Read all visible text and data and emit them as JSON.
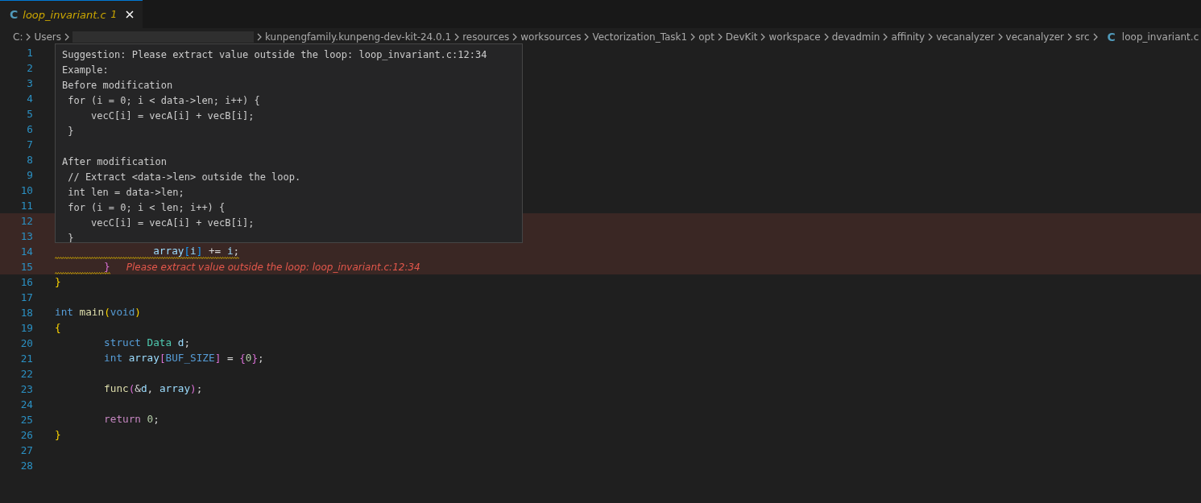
{
  "tabs": [
    {
      "icon": "C",
      "label": "loop_invariant.c",
      "problems": "1",
      "selected": true
    }
  ],
  "breadcrumb": [
    {
      "kind": "folder",
      "label": "C:"
    },
    {
      "kind": "folder",
      "label": "Users"
    },
    {
      "kind": "redacted"
    },
    {
      "kind": "folder",
      "label": "kunpengfamily.kunpeng-dev-kit-24.0.1"
    },
    {
      "kind": "folder",
      "label": "resources"
    },
    {
      "kind": "folder",
      "label": "worksources"
    },
    {
      "kind": "folder",
      "label": "Vectorization_Task1"
    },
    {
      "kind": "folder",
      "label": "opt"
    },
    {
      "kind": "folder",
      "label": "DevKit"
    },
    {
      "kind": "folder",
      "label": "workspace"
    },
    {
      "kind": "folder",
      "label": "devadmin"
    },
    {
      "kind": "folder",
      "label": "affinity"
    },
    {
      "kind": "folder",
      "label": "vecanalyzer"
    },
    {
      "kind": "folder",
      "label": "vecanalyzer"
    },
    {
      "kind": "folder",
      "label": "src"
    },
    {
      "kind": "file",
      "icon": "C",
      "label": "loop_invariant.c"
    }
  ],
  "lines": [
    {
      "number": "1",
      "highlighted": false
    },
    {
      "number": "2",
      "highlighted": false
    },
    {
      "number": "3",
      "highlighted": false
    },
    {
      "number": "4",
      "highlighted": false
    },
    {
      "number": "5",
      "highlighted": false
    },
    {
      "number": "6",
      "highlighted": false
    },
    {
      "number": "7",
      "highlighted": false
    },
    {
      "number": "8",
      "highlighted": false
    },
    {
      "number": "9",
      "highlighted": false
    },
    {
      "number": "10",
      "highlighted": false
    },
    {
      "number": "11",
      "highlighted": false
    },
    {
      "number": "12",
      "highlighted": true
    },
    {
      "number": "13",
      "highlighted": true
    },
    {
      "number": "14",
      "highlighted": true,
      "squiggle": true,
      "tokens": [
        {
          "t": "\t\tarray",
          "kind": "variable"
        },
        {
          "t": "[",
          "kind": "bracket3"
        },
        {
          "t": "i",
          "kind": "variable"
        },
        {
          "t": "]",
          "kind": "bracket3"
        },
        {
          "t": " += ",
          "kind": "plain"
        },
        {
          "t": "i",
          "kind": "variable"
        },
        {
          "t": ";",
          "kind": "plain"
        }
      ]
    },
    {
      "number": "15",
      "highlighted": true,
      "squiggle": true,
      "tokens": [
        {
          "t": "\t}",
          "kind": "bracket2"
        }
      ],
      "diagnostic": "Please extract value outside the loop: loop_invariant.c:12:34"
    },
    {
      "number": "16",
      "highlighted": false,
      "squiggle": false,
      "tokens": [
        {
          "t": "}",
          "kind": "bracket1"
        }
      ]
    },
    {
      "number": "17",
      "highlighted": false
    },
    {
      "number": "18",
      "highlighted": false,
      "squiggle": false,
      "tokens": [
        {
          "t": "int",
          "kind": "keyword"
        },
        {
          "t": " main",
          "kind": "function"
        },
        {
          "t": "(",
          "kind": "bracket1"
        },
        {
          "t": "void",
          "kind": "keyword"
        },
        {
          "t": ")",
          "kind": "bracket1"
        }
      ]
    },
    {
      "number": "19",
      "highlighted": false,
      "squiggle": false,
      "tokens": [
        {
          "t": "{",
          "kind": "bracket1"
        }
      ]
    },
    {
      "number": "20",
      "highlighted": false,
      "squiggle": false,
      "tokens": [
        {
          "t": "\tstruct",
          "kind": "keyword"
        },
        {
          "t": " Data",
          "kind": "type"
        },
        {
          "t": " d",
          "kind": "variable"
        },
        {
          "t": ";",
          "kind": "plain"
        }
      ]
    },
    {
      "number": "21",
      "highlighted": false,
      "squiggle": false,
      "tokens": [
        {
          "t": "\tint",
          "kind": "keyword"
        },
        {
          "t": " array",
          "kind": "variable"
        },
        {
          "t": "[",
          "kind": "bracket2"
        },
        {
          "t": "BUF_SIZE",
          "kind": "macro"
        },
        {
          "t": "]",
          "kind": "bracket2"
        },
        {
          "t": " = ",
          "kind": "plain"
        },
        {
          "t": "{",
          "kind": "bracket2"
        },
        {
          "t": "0",
          "kind": "number"
        },
        {
          "t": "}",
          "kind": "bracket2"
        },
        {
          "t": ";",
          "kind": "plain"
        }
      ]
    },
    {
      "number": "22",
      "highlighted": false
    },
    {
      "number": "23",
      "highlighted": false,
      "squiggle": false,
      "tokens": [
        {
          "t": "\tfunc",
          "kind": "function"
        },
        {
          "t": "(",
          "kind": "bracket2"
        },
        {
          "t": "&",
          "kind": "plain"
        },
        {
          "t": "d",
          "kind": "variable"
        },
        {
          "t": ", ",
          "kind": "plain"
        },
        {
          "t": "array",
          "kind": "variable"
        },
        {
          "t": ")",
          "kind": "bracket2"
        },
        {
          "t": ";",
          "kind": "plain"
        }
      ]
    },
    {
      "number": "24",
      "highlighted": false
    },
    {
      "number": "25",
      "highlighted": false,
      "squiggle": false,
      "tokens": [
        {
          "t": "\treturn",
          "kind": "control"
        },
        {
          "t": " 0",
          "kind": "number"
        },
        {
          "t": ";",
          "kind": "plain"
        }
      ]
    },
    {
      "number": "26",
      "highlighted": false,
      "squiggle": false,
      "tokens": [
        {
          "t": "}",
          "kind": "bracket1"
        }
      ]
    },
    {
      "number": "27",
      "highlighted": false
    },
    {
      "number": "28",
      "highlighted": false
    }
  ],
  "hover": {
    "text": "Suggestion: Please extract value outside the loop: loop_invariant.c:12:34\nExample:\nBefore modification\n for (i = 0; i < data->len; i++) {\n     vecC[i] = vecA[i] + vecB[i];\n }\n\nAfter modification\n // Extract <data->len> outside the loop.\n int len = data->len;\n for (i = 0; i < len; i++) {\n     vecC[i] = vecA[i] + vecB[i];\n }"
  }
}
